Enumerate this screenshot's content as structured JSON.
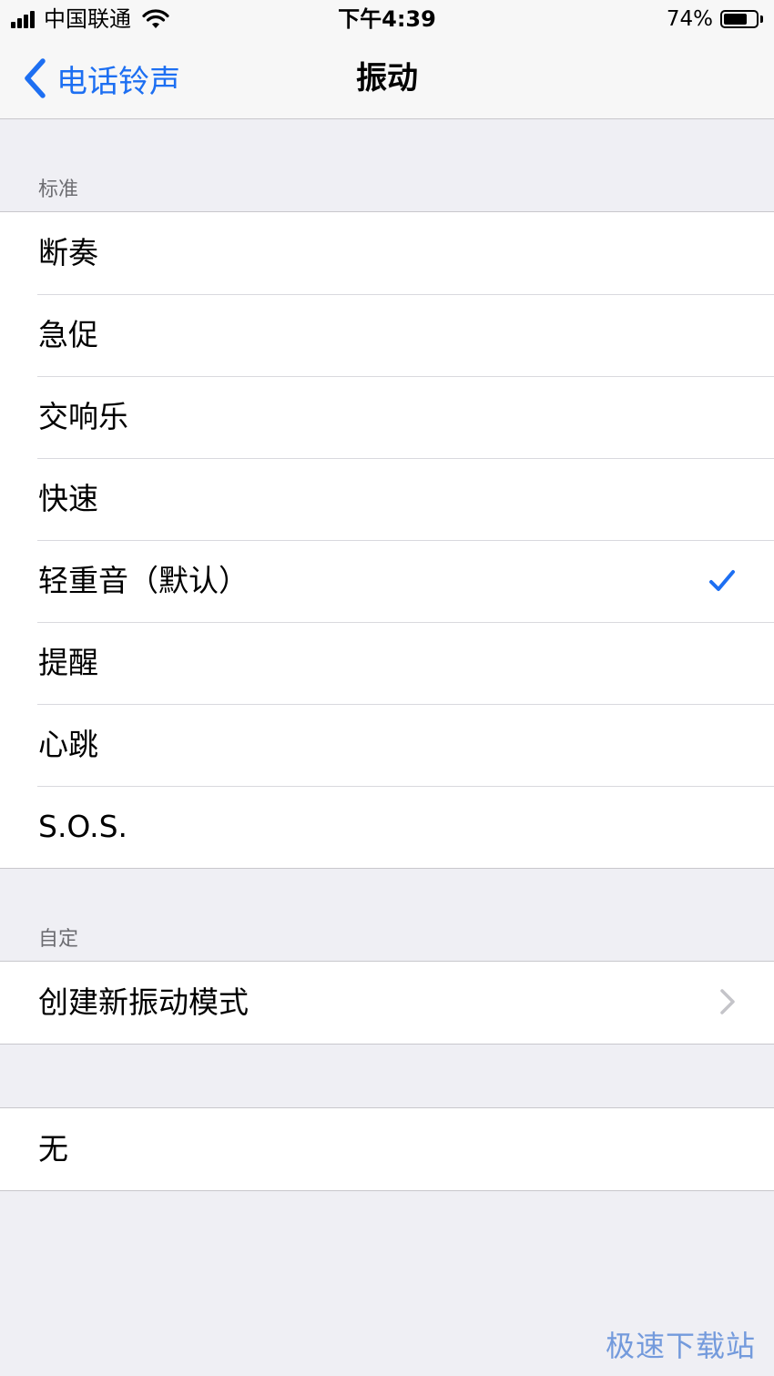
{
  "status_bar": {
    "carrier": "中国联通",
    "time": "下午4:39",
    "battery_percent": "74%",
    "battery_level": 0.74,
    "icons": [
      "cellular-signal-icon",
      "wifi-icon",
      "battery-icon"
    ]
  },
  "nav": {
    "back_label": "电话铃声",
    "title": "振动",
    "back_icon": "chevron-left-icon",
    "accent_color": "#1d6ff2"
  },
  "standard_section": {
    "header": "标准",
    "items": [
      {
        "label": "断奏",
        "selected": false
      },
      {
        "label": "急促",
        "selected": false
      },
      {
        "label": "交响乐",
        "selected": false
      },
      {
        "label": "快速",
        "selected": false
      },
      {
        "label": "轻重音（默认）",
        "selected": true
      },
      {
        "label": "提醒",
        "selected": false
      },
      {
        "label": "心跳",
        "selected": false
      },
      {
        "label": "S.O.S.",
        "selected": false
      }
    ]
  },
  "custom_section": {
    "header": "自定",
    "create_label": "创建新振动模式"
  },
  "none_section": {
    "none_label": "无"
  },
  "watermark": "极速下载站"
}
